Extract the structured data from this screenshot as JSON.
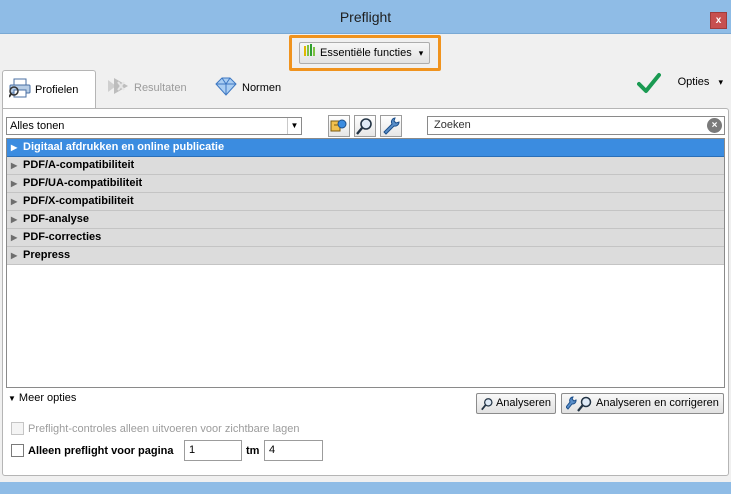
{
  "window": {
    "title": "Preflight",
    "close_label": "x"
  },
  "toolbar": {
    "essentials_label": "Essentiële functies",
    "essentials_dropdown": "▾"
  },
  "tabs": [
    {
      "label": "Profielen",
      "icon": "printer-icon",
      "active": true
    },
    {
      "label": "Resultaten",
      "icon": "results-icon",
      "disabled": true
    },
    {
      "label": "Normen",
      "icon": "diamond-icon"
    }
  ],
  "options": {
    "label": "Opties",
    "dropdown": "▾"
  },
  "filter": {
    "selected": "Alles tonen"
  },
  "search": {
    "placeholder": "Zoeken"
  },
  "profiles": [
    {
      "label": "Digitaal afdrukken en online publicatie",
      "selected": true
    },
    {
      "label": "PDF/A-compatibiliteit"
    },
    {
      "label": "PDF/UA-compatibiliteit"
    },
    {
      "label": "PDF/X-compatibiliteit"
    },
    {
      "label": "PDF-analyse"
    },
    {
      "label": "PDF-correcties"
    },
    {
      "label": "Prepress"
    }
  ],
  "more_options": {
    "label": "Meer opties"
  },
  "actions": {
    "analyze": "Analyseren",
    "analyze_fix": "Analyseren en corrigeren"
  },
  "settings": {
    "visible_layers_label": "Preflight-controles alleen uitvoeren voor zichtbare lagen",
    "page_range_label": "Alleen preflight voor pagina",
    "page_from": "1",
    "page_to_label": "tm",
    "page_to": "4"
  },
  "colors": {
    "accent_orange": "#f0931e",
    "selection_blue": "#3b8ce0",
    "check_green": "#1a9a52"
  }
}
